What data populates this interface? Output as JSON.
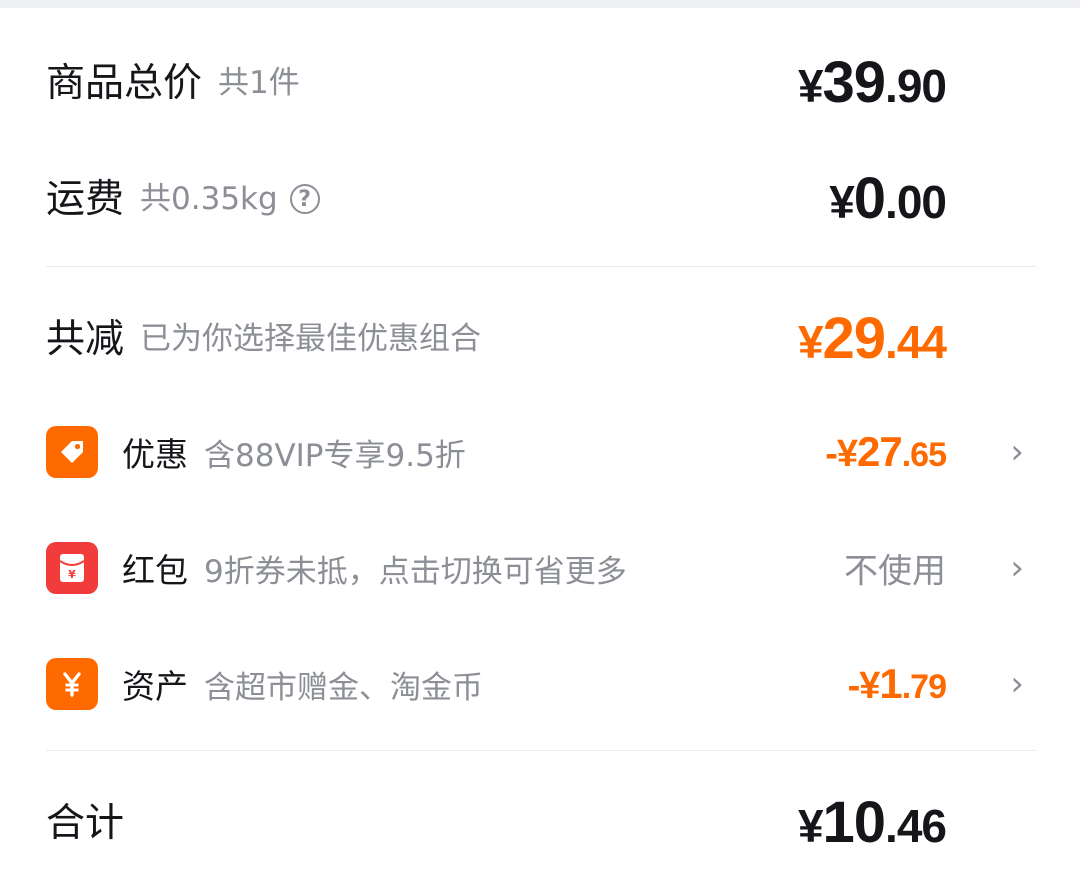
{
  "goods": {
    "title": "商品总价",
    "count": "共1件",
    "price": {
      "currency": "¥",
      "integer": "39",
      "decimal": ".90"
    }
  },
  "shipping": {
    "title": "运费",
    "weight": "共0.35kg",
    "help_icon": "?",
    "price": {
      "currency": "¥",
      "integer": "0",
      "decimal": ".00"
    }
  },
  "reduction": {
    "title": "共减",
    "desc": "已为你选择最佳优惠组合",
    "price": {
      "currency": "¥",
      "integer": "29",
      "decimal": ".44"
    }
  },
  "items": [
    {
      "title": "优惠",
      "desc": "含88VIP专享9.5折",
      "price": {
        "prefix": "-",
        "currency": "¥",
        "integer": "27",
        "decimal": ".65"
      },
      "icon": "tag-icon",
      "color": "#ff6a00"
    },
    {
      "title": "红包",
      "desc": "9折券未抵，点击切换可省更多",
      "status": "不使用",
      "icon": "red-envelope-icon",
      "color": "#f23c3c"
    },
    {
      "title": "资产",
      "desc": "含超市赠金、淘金币",
      "price": {
        "prefix": "-",
        "currency": "¥",
        "integer": "1",
        "decimal": ".79"
      },
      "icon": "yen-icon",
      "color": "#ff6a00"
    }
  ],
  "chevron": "›",
  "total": {
    "title": "合计",
    "price": {
      "currency": "¥",
      "integer": "10",
      "decimal": ".46"
    }
  },
  "colors": {
    "accent": "#ff6a00",
    "red": "#f23c3c",
    "text": "#15161a",
    "muted": "#8c8f96"
  }
}
